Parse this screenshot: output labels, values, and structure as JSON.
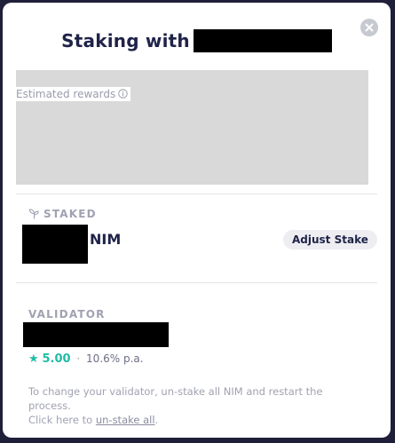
{
  "modal": {
    "title": "Staking with",
    "close_icon": "close-icon"
  },
  "rewards": {
    "label": "Estimated rewards",
    "info_icon": "info-icon"
  },
  "staked": {
    "label": "STAKED",
    "icon": "sprout-icon",
    "unit": "NIM",
    "adjust_button": "Adjust Stake"
  },
  "validator": {
    "label": "VALIDATOR",
    "star_icon": "star-icon",
    "rating": "5.00",
    "separator": "·",
    "apy": "10.6% p.a.",
    "help_text_1": "To change your validator, un-stake all NIM and restart the process.",
    "help_text_2": "Click here to",
    "unstake_link": "un-stake all",
    "help_text_end": "."
  },
  "colors": {
    "accent_green": "#21bca5",
    "title_navy": "#1f2348",
    "muted_text": "#a0a2b2",
    "placeholder_gray": "#d9d9d9"
  }
}
